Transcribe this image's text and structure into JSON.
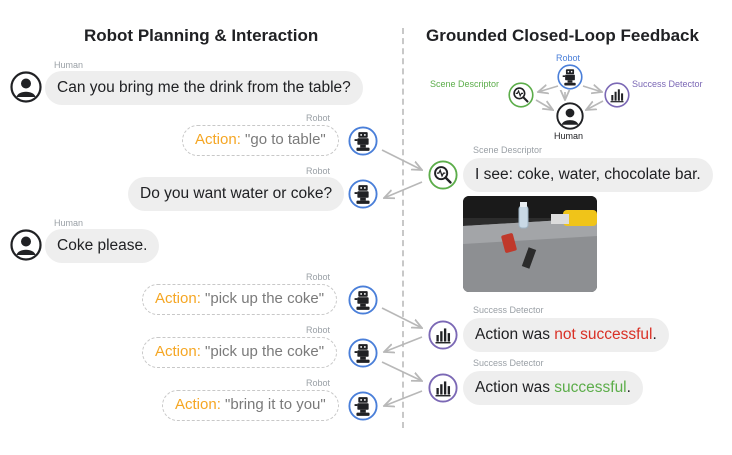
{
  "left": {
    "title": "Robot Planning & Interaction",
    "messages": [
      {
        "speaker": "Human",
        "text": "Can you bring me the drink from the table?"
      },
      {
        "speaker": "Robot",
        "prefix": "Action:",
        "text": " \"go to table\""
      },
      {
        "speaker": "Robot",
        "text": "Do you want water or coke?"
      },
      {
        "speaker": "Human",
        "text": "Coke please."
      },
      {
        "speaker": "Robot",
        "prefix": "Action:",
        "text": " \"pick up the coke\""
      },
      {
        "speaker": "Robot",
        "prefix": "Action:",
        "text": " \"pick up the coke\""
      },
      {
        "speaker": "Robot",
        "prefix": "Action:",
        "text": " \"bring it to you\""
      }
    ]
  },
  "right": {
    "title": "Grounded Closed-Loop Feedback",
    "legend": {
      "robot": "Robot",
      "scene_descriptor": "Scene Descriptor",
      "success_detector": "Success Detector",
      "human": "Human"
    },
    "scene": {
      "speaker": "Scene Descriptor",
      "text": "I see: coke, water, chocolate bar."
    },
    "fail": {
      "speaker": "Success Detector",
      "prefix": "Action was ",
      "highlight": "not successful",
      "suffix": "."
    },
    "success": {
      "speaker": "Success Detector",
      "prefix": "Action was ",
      "highlight": "successful",
      "suffix": "."
    }
  },
  "colors": {
    "action": "#f5a623",
    "not_successful": "#d93025",
    "successful": "#5cad4a",
    "robot_blue": "#4a7fd9",
    "scene_green": "#5cad4a",
    "detector_purple": "#7b68b5"
  },
  "icons": [
    "human-icon",
    "robot-icon",
    "scene-descriptor-icon",
    "success-detector-icon"
  ]
}
